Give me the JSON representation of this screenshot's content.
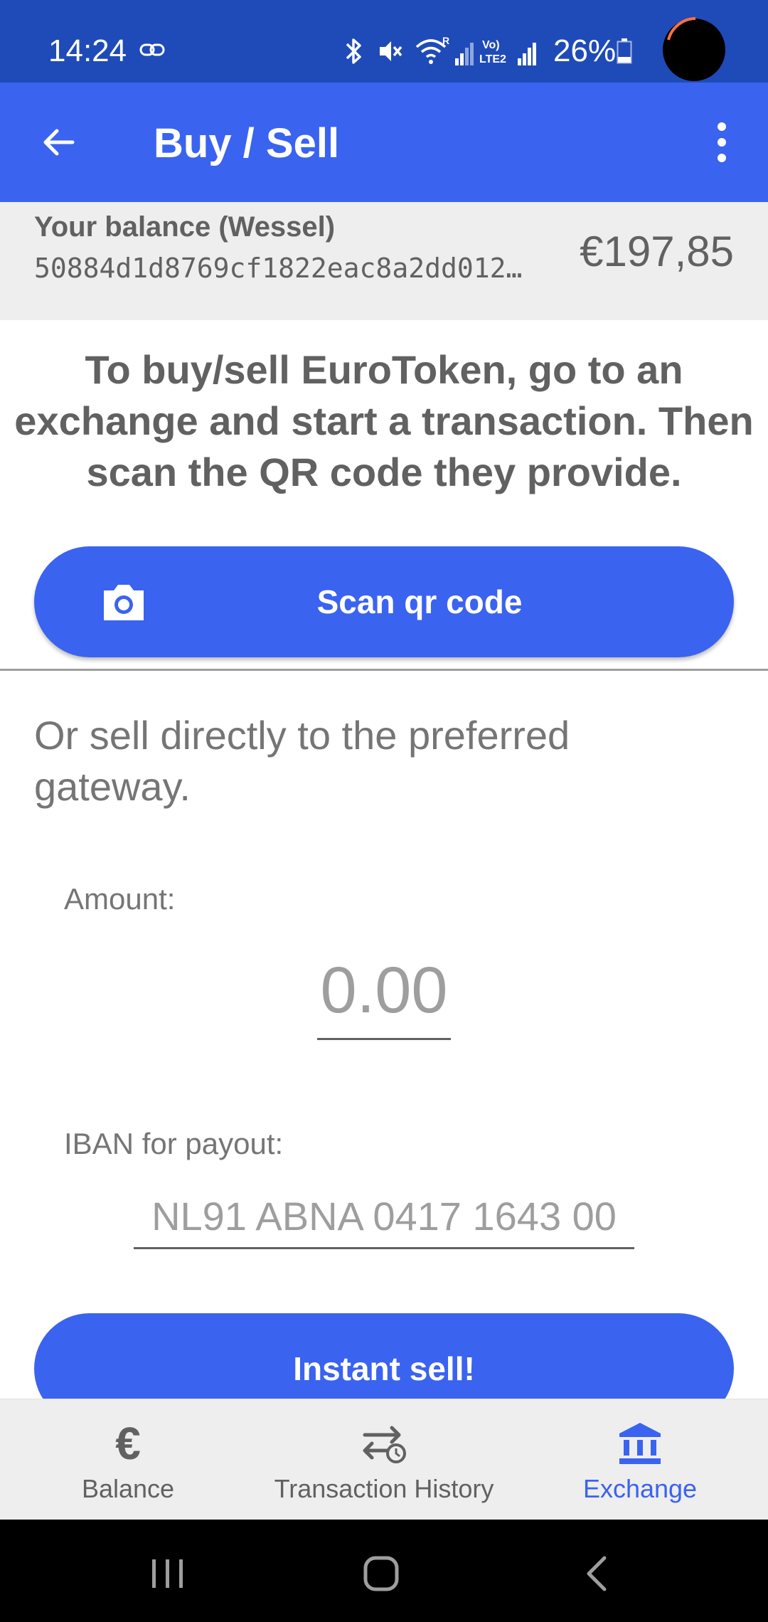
{
  "status_bar": {
    "time": "14:24",
    "battery": "26%",
    "background": "#1f4bb8"
  },
  "app_bar": {
    "title": "Buy / Sell",
    "background": "#3a63f0"
  },
  "balance": {
    "owner_label": "Your balance (Wessel)",
    "public_key": "50884d1d8769cf1822eac8a2dd012…",
    "amount": "€197,85"
  },
  "instructions": "To buy/sell EuroToken, go to an exchange and start a transaction. Then scan the QR code they provide.",
  "scan_button": {
    "label": "Scan qr code",
    "icon": "camera-icon"
  },
  "sell_direct_text": "Or sell directly to the preferred gateway.",
  "amount": {
    "label": "Amount:",
    "placeholder": "0.00"
  },
  "iban": {
    "label": "IBAN for payout:",
    "placeholder": "NL91 ABNA 0417 1643 00"
  },
  "sell_button": {
    "label": "Instant sell!"
  },
  "bottom_nav": {
    "items": [
      {
        "label": "Balance",
        "icon": "euro-icon",
        "active": false
      },
      {
        "label": "Transaction History",
        "icon": "transfer-history-icon",
        "active": false
      },
      {
        "label": "Exchange",
        "icon": "bank-icon",
        "active": true
      }
    ],
    "active_color": "#3a63f0"
  }
}
